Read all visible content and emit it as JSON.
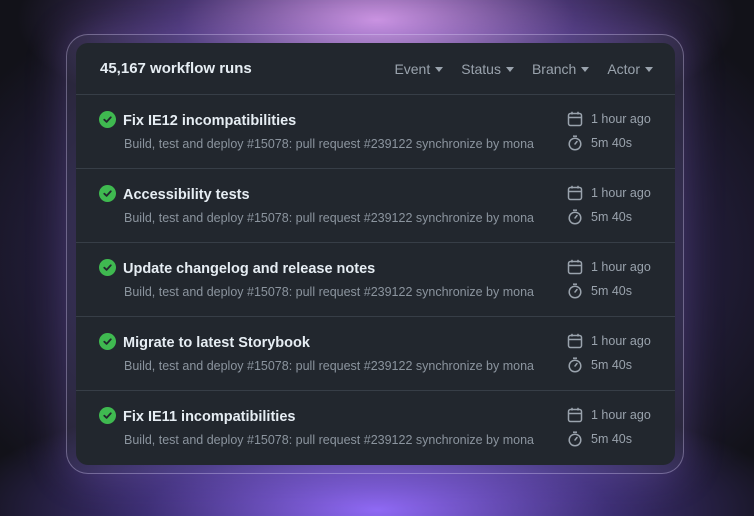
{
  "header": {
    "title": "45,167 workflow runs",
    "filters": [
      "Event",
      "Status",
      "Branch",
      "Actor"
    ]
  },
  "runs": [
    {
      "title": "Fix IE12 incompatibilities",
      "subtitle": "Build, test and deploy #15078: pull request #239122 synchronize by mona",
      "time": "1 hour ago",
      "duration": "5m 40s",
      "status": "success"
    },
    {
      "title": "Accessibility tests",
      "subtitle": "Build, test and deploy #15078: pull request #239122 synchronize by mona",
      "time": "1 hour ago",
      "duration": "5m 40s",
      "status": "success"
    },
    {
      "title": "Update changelog and release notes",
      "subtitle": "Build, test and deploy #15078: pull request #239122 synchronize by mona",
      "time": "1 hour ago",
      "duration": "5m 40s",
      "status": "success"
    },
    {
      "title": "Migrate to latest Storybook",
      "subtitle": "Build, test and deploy #15078: pull request #239122 synchronize by mona",
      "time": "1 hour ago",
      "duration": "5m 40s",
      "status": "success"
    },
    {
      "title": "Fix IE11 incompatibilities",
      "subtitle": "Build, test and deploy #15078: pull request #239122 synchronize by mona",
      "time": "1 hour ago",
      "duration": "5m 40s",
      "status": "success"
    }
  ],
  "colors": {
    "success": "#3fb950",
    "panel": "#22272e",
    "text_primary": "#e6edf3",
    "text_muted": "#8b949e"
  },
  "icons": {
    "status": "check-circle-icon",
    "time": "calendar-icon",
    "duration": "stopwatch-icon",
    "filter": "caret-down-icon"
  }
}
